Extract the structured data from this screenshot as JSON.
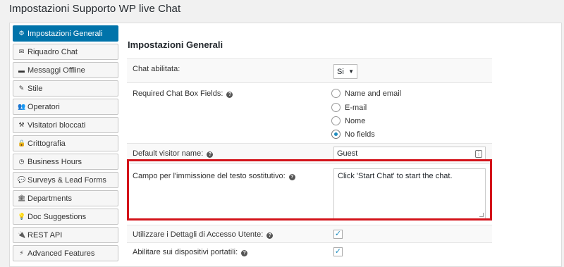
{
  "page": {
    "title": "Impostazioni Supporto WP live Chat"
  },
  "tabs": [
    {
      "icon": "gear-icon",
      "glyph": "⚙",
      "label": "Impostazioni Generali",
      "active": true
    },
    {
      "icon": "envelope-icon",
      "glyph": "✉",
      "label": "Riquadro Chat"
    },
    {
      "icon": "book-icon",
      "glyph": "▬",
      "label": "Messaggi Offline"
    },
    {
      "icon": "pencil-icon",
      "glyph": "✎",
      "label": "Stile"
    },
    {
      "icon": "users-icon",
      "glyph": "👥",
      "label": "Operatori"
    },
    {
      "icon": "gavel-icon",
      "glyph": "⚒",
      "label": "Visitatori bloccati"
    },
    {
      "icon": "lock-icon",
      "glyph": "🔒",
      "label": "Crittografia"
    },
    {
      "icon": "clock-icon",
      "glyph": "◷",
      "label": "Business Hours"
    },
    {
      "icon": "comment-icon",
      "glyph": "💬",
      "label": "Surveys & Lead Forms"
    },
    {
      "icon": "building-icon",
      "glyph": "🏛",
      "label": "Departments"
    },
    {
      "icon": "lightbulb-icon",
      "glyph": "💡",
      "label": "Doc Suggestions"
    },
    {
      "icon": "plug-icon",
      "glyph": "🔌",
      "label": "REST API"
    },
    {
      "icon": "bolt-icon",
      "glyph": "⚡",
      "label": "Advanced Features"
    }
  ],
  "main": {
    "section_title": "Impostazioni Generali",
    "chat_enabled": {
      "label": "Chat abilitata:",
      "value": "Si"
    },
    "required_fields": {
      "label": "Required Chat Box Fields:",
      "options": [
        {
          "label": "Name and email",
          "checked": false
        },
        {
          "label": "E-mail",
          "checked": false
        },
        {
          "label": "Nome",
          "checked": false
        },
        {
          "label": "No fields",
          "checked": true
        }
      ]
    },
    "default_visitor": {
      "label": "Default visitor name:",
      "value": "Guest"
    },
    "placeholder_field": {
      "label": "Campo per l'immissione del testo sostitutivo:",
      "value": "Click 'Start Chat' to start the chat."
    },
    "user_access": {
      "label": "Utilizzare i Dettagli di Accesso Utente:",
      "checked": true
    },
    "mobile": {
      "label": "Abilitare sui dispositivi portatili:",
      "checked": true
    }
  },
  "colors": {
    "accent": "#0073aa",
    "highlight": "#d3131a"
  }
}
